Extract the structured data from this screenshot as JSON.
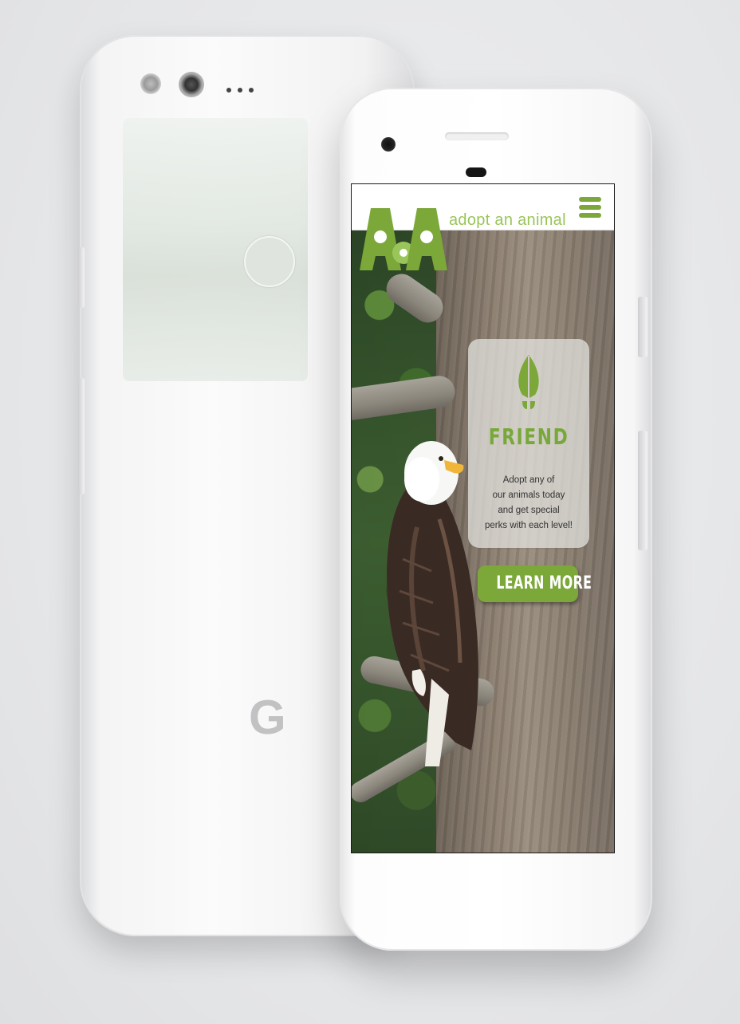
{
  "colors": {
    "brand_green": "#7ba838",
    "brand_light_green": "#9ac55a",
    "device_silver": "#f4f4f5"
  },
  "device_back": {
    "logo_letter": "G"
  },
  "app": {
    "brand_text": "adopt an animal",
    "logo_alt": "AoA",
    "menu_icon": "hamburger-menu-icon"
  },
  "hero": {
    "image": "bald-eagle-on-tree-branch"
  },
  "card": {
    "icon": "leaf-icon",
    "title": "FRIEND",
    "text_lines": [
      "Adopt any of",
      "our animals today",
      "and get special",
      "perks with each level!"
    ]
  },
  "cta": {
    "label": "LEARN MORE"
  }
}
